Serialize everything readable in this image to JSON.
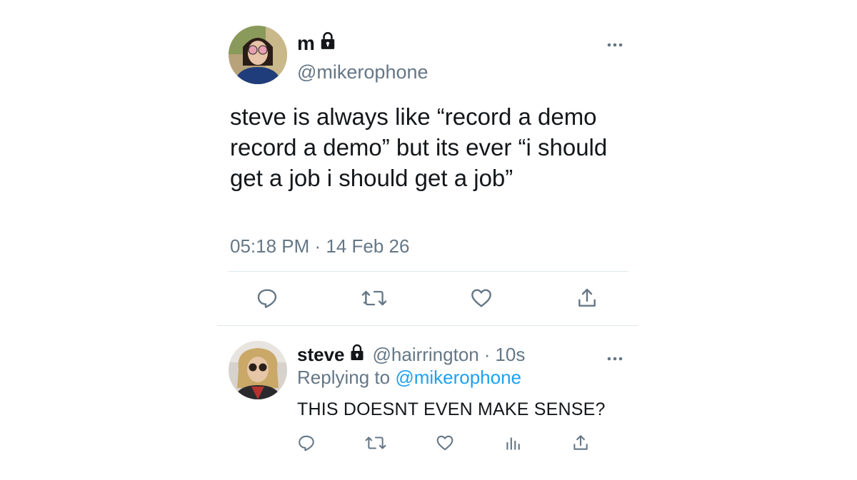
{
  "main_tweet": {
    "display_name": "m",
    "handle": "@mikerophone",
    "text": "steve is always like “record a demo record a demo” but its ever “i should get a job i should get a job”",
    "timestamp": "05:18 PM · 14 Feb 26",
    "icons": {
      "lock": "lock-icon",
      "more": "more-horizontal-icon",
      "reply": "reply-icon",
      "retweet": "retweet-icon",
      "like": "heart-icon",
      "share": "share-icon"
    }
  },
  "reply_tweet": {
    "display_name": "steve",
    "handle": "@hairrington",
    "separator": "·",
    "time_ago": "10s",
    "replying_prefix": "Replying to",
    "replying_to": "@mikerophone",
    "text": "THIS DOESNT EVEN MAKE SENSE?",
    "icons": {
      "lock": "lock-icon",
      "more": "more-horizontal-icon",
      "reply": "reply-icon",
      "retweet": "retweet-icon",
      "like": "heart-icon",
      "analytics": "analytics-icon",
      "share": "share-icon"
    }
  },
  "colors": {
    "text_primary": "#14171a",
    "text_secondary": "#657786",
    "link": "#1da1f2",
    "divider": "#e1e8ed"
  }
}
